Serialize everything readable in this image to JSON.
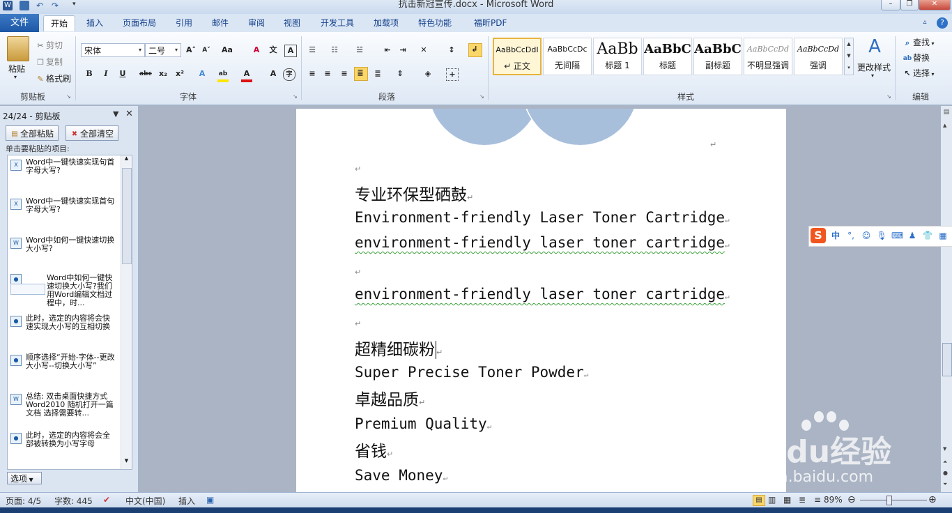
{
  "window": {
    "title": "抗击新冠宣传.docx - Microsoft Word",
    "controls": [
      "minimize-icon",
      "restore-icon",
      "close-icon"
    ]
  },
  "tabs": {
    "file": "文件",
    "items": [
      "开始",
      "插入",
      "页面布局",
      "引用",
      "邮件",
      "审阅",
      "视图",
      "开发工具",
      "加载项",
      "特色功能",
      "福昕PDF"
    ],
    "help": "?"
  },
  "ribbon": {
    "clipboard": {
      "label": "剪贴板",
      "paste": "粘贴",
      "cut": "剪切",
      "copy": "复制",
      "format_painter": "格式刷"
    },
    "font": {
      "label": "字体",
      "font_name": "宋体",
      "font_size": "二号"
    },
    "paragraph": {
      "label": "段落"
    },
    "styles": {
      "label": "样式",
      "change_styles": "更改样式",
      "tiles": [
        {
          "preview": "AaBbCcDdI",
          "name": "↵ 正文"
        },
        {
          "preview": "AaBbCcDc",
          "name": "无间隔"
        },
        {
          "preview": "AaBb",
          "name": "标题 1"
        },
        {
          "preview": "AaBbC",
          "name": "标题"
        },
        {
          "preview": "AaBbC",
          "name": "副标题"
        },
        {
          "preview": "AaBbCcDd",
          "name": "不明显强调"
        },
        {
          "preview": "AaBbCcDd",
          "name": "强调"
        }
      ]
    },
    "editing": {
      "label": "编辑",
      "find": "查找",
      "replace": "替换",
      "select": "选择"
    }
  },
  "clipboard_pane": {
    "title": "24/24 - 剪贴板",
    "paste_all": "全部粘贴",
    "clear_all": "全部清空",
    "hint": "单击要粘贴的项目:",
    "options": "选项",
    "items": [
      {
        "icon": "excel-doc-icon",
        "text": "Word中一键快速实现句首字母大写?"
      },
      {
        "icon": "excel-doc-icon",
        "text": "Word中一键快速实现首句字母大写?"
      },
      {
        "icon": "word-doc-icon",
        "text": "Word中如何一键快速切换大小写?"
      },
      {
        "icon": "image-clip-icon",
        "text": "Word中如何一键快速切换大小写?我们用Word编辑文档过程中，时..."
      },
      {
        "icon": "web-clip-icon",
        "text": "此时，选定的内容将会快速实现大小写的互相切换"
      },
      {
        "icon": "web-clip-icon",
        "text": "顺序选择“开始-字体--更改大小写--切换大小写”"
      },
      {
        "icon": "word-doc-icon",
        "text": "总结: 双击桌面快捷方式Word2010 随机打开一篇文档 选择需要转..."
      },
      {
        "icon": "web-clip-icon",
        "text": "此时，选定的内容将会全部被转换为小写字母"
      }
    ]
  },
  "document": {
    "lines": [
      {
        "text": "专业环保型硒鼓",
        "kind": "zh"
      },
      {
        "text": "Environment-friendly Laser Toner Cartridge",
        "kind": "en"
      },
      {
        "text": "environment-friendly laser toner cartridge",
        "kind": "en"
      },
      {
        "text": "environment-friendly laser toner cartridge",
        "kind": "en"
      },
      {
        "text": "超精细碳粉",
        "kind": "zh"
      },
      {
        "text": "Super Precise Toner Powder",
        "kind": "en"
      },
      {
        "text": "卓越品质",
        "kind": "zh"
      },
      {
        "text": "Premium Quality",
        "kind": "en"
      },
      {
        "text": "省钱",
        "kind": "zh"
      },
      {
        "text": "Save Money",
        "kind": "en"
      }
    ]
  },
  "statusbar": {
    "page": "页面: 4/5",
    "words": "字数: 445",
    "language": "中文(中国)",
    "mode": "插入",
    "zoom": "89%"
  },
  "ime": {
    "mode": "中"
  },
  "watermark": {
    "brand": "Baidu经验",
    "url": "jingyan.baidu.com"
  },
  "colors": {
    "tab_file": "#2a66b3",
    "accent": "#15428b",
    "circle": "#a8bfdc"
  }
}
